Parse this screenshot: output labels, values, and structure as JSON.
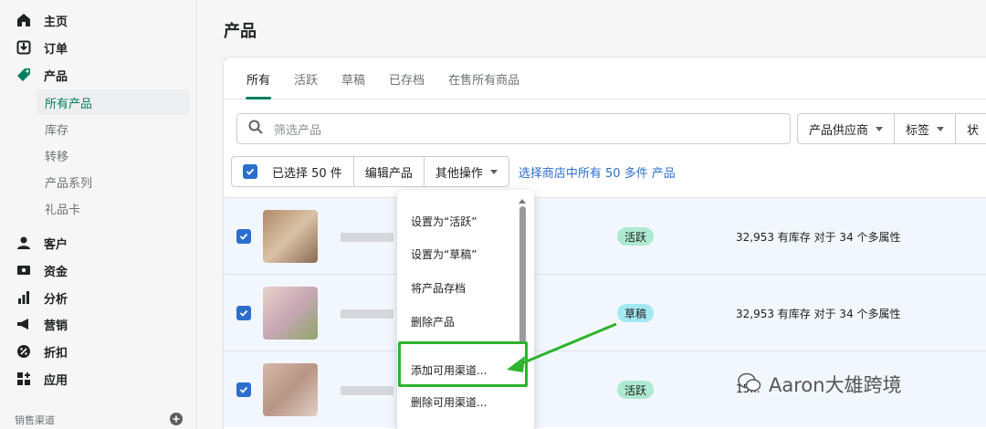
{
  "sidebar": {
    "items": [
      {
        "label": "主页",
        "icon": "home-icon"
      },
      {
        "label": "订单",
        "icon": "orders-icon"
      },
      {
        "label": "产品",
        "icon": "tag-icon"
      }
    ],
    "subitems": [
      {
        "label": "所有产品"
      },
      {
        "label": "库存"
      },
      {
        "label": "转移"
      },
      {
        "label": "产品系列"
      },
      {
        "label": "礼品卡"
      }
    ],
    "items2": [
      {
        "label": "客户",
        "icon": "customer-icon"
      },
      {
        "label": "资金",
        "icon": "finance-icon"
      },
      {
        "label": "分析",
        "icon": "analytics-icon"
      },
      {
        "label": "营销",
        "icon": "marketing-icon"
      },
      {
        "label": "折扣",
        "icon": "discount-icon"
      },
      {
        "label": "应用",
        "icon": "apps-icon"
      }
    ],
    "section_label": "销售渠道"
  },
  "page": {
    "title": "产品"
  },
  "tabs": [
    "所有",
    "活跃",
    "草稿",
    "已存档",
    "在售所有商品"
  ],
  "search": {
    "placeholder": "筛选产品"
  },
  "filters": [
    "产品供应商",
    "标签",
    "状"
  ],
  "bulk": {
    "selected": "已选择 50 件",
    "edit": "编辑产品",
    "more": "其他操作",
    "select_all_link": "选择商店中所有 50 多件 产品"
  },
  "rows": [
    {
      "status": "活跃",
      "stock": "32,953 有库存 对于 34 个多属性"
    },
    {
      "status": "草稿",
      "stock": "32,953 有库存 对于 34 个多属性"
    },
    {
      "status": "活跃",
      "stock": "15..."
    }
  ],
  "dropdown": {
    "items": [
      "设置为“活跃”",
      "设置为“草稿”",
      "将产品存档",
      "删除产品",
      "添加可用渠道...",
      "删除可用渠道..."
    ]
  },
  "watermark": {
    "text": "Aaron大雄跨境"
  },
  "colors": {
    "accent": "#008060",
    "checkbox": "#2c6ecb",
    "highlight": "#2db32d",
    "selected_row": "#f2f7fe"
  }
}
